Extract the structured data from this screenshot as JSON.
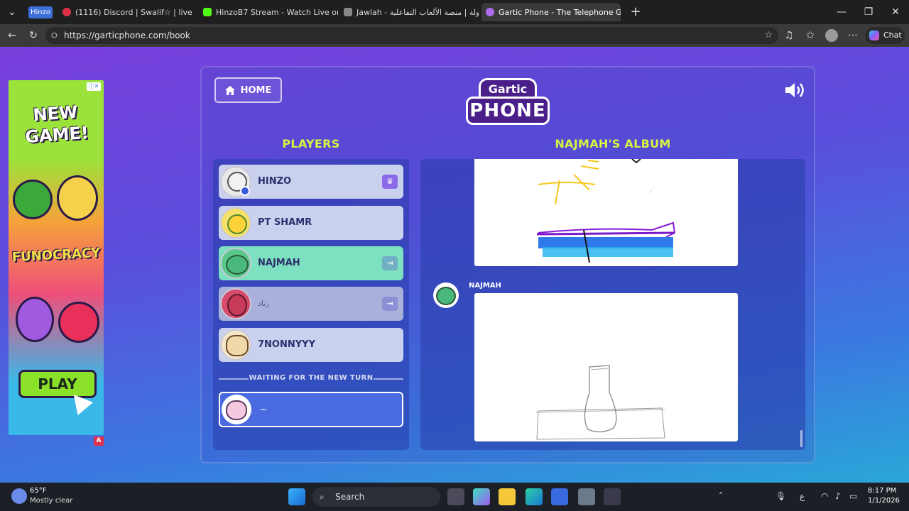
{
  "browser": {
    "profile_label": "Hinzo",
    "tabs": [
      {
        "title": "(1116) Discord | Swalif☆ | live",
        "fav_color": "#e0304a"
      },
      {
        "title": "HinzoB7 Stream - Watch Live on K",
        "fav_color": "#53fc18"
      },
      {
        "title": "جولة | منصة الألعاب التفاعلية - Jawlah",
        "fav_color": "#888888"
      },
      {
        "title": "Gartic Phone - The Telephone Gam",
        "fav_color": "#b06cf0"
      }
    ],
    "url": "https://garticphone.com/book",
    "chat_label": "Chat"
  },
  "ad": {
    "headline": "NEW GAME!",
    "brand": "FUNOCRACY",
    "play_label": "PLAY",
    "corner_badge": "A"
  },
  "game": {
    "home_label": "HOME",
    "logo_top": "Gartic",
    "logo_bottom": "PHONE",
    "players_title": "PLAYERS",
    "album_title": "NAJMAH'S ALBUM",
    "players": [
      {
        "name": "HINZO",
        "badge": "♛",
        "status": "host"
      },
      {
        "name": "PT SHAMR",
        "badge": "",
        "status": "normal"
      },
      {
        "name": "NAJMAH",
        "badge": "⇥",
        "status": "active"
      },
      {
        "name": "رناد",
        "badge": "⇥",
        "status": "away"
      },
      {
        "name": "7NONNYYY",
        "badge": "",
        "status": "normal"
      }
    ],
    "waiting_label": "WAITING FOR THE NEW TURN",
    "waiting_player": "~",
    "album_author": "NAJMAH",
    "colors": {
      "accent": "#d7f542",
      "active_player": "#7de0c0",
      "player_bg": "#c9d1ef"
    }
  },
  "taskbar": {
    "temp": "65°F",
    "weather": "Mostly clear",
    "search_placeholder": "Search",
    "time": "8:17 PM",
    "date": "1/1/2026",
    "lang": "ع"
  }
}
